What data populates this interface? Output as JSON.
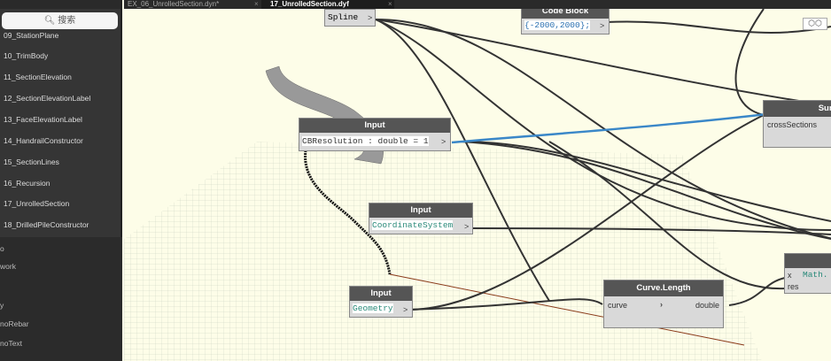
{
  "sidebar": {
    "search_placeholder": "搜索",
    "items": [
      "09_StationPlane",
      "10_TrimBody",
      "11_SectionElevation",
      "12_SectionElevationLabel",
      "13_FaceElevationLabel",
      "14_HandrailConstructor",
      "15_SectionLines",
      "16_Recursion",
      "17_UnrolledSection",
      "18_DrilledPileConstructor"
    ],
    "lower_items": [
      "o",
      "work",
      "",
      "y",
      "noRebar",
      "noText"
    ]
  },
  "tabs": [
    {
      "label": "EX_06_UnrolledSection.dyn*"
    },
    {
      "label": "17_UnrolledSection.dyf"
    }
  ],
  "nodes": {
    "spline": {
      "output": "Spline"
    },
    "code_block": {
      "title": "Code Block",
      "code": "{-2000,2000};"
    },
    "input_cb": {
      "title": "Input",
      "code": "CBResolution : double = 1"
    },
    "input_cs": {
      "title": "Input",
      "code": "CoordinateSystem"
    },
    "input_geo": {
      "title": "Input",
      "code": "Geometry"
    },
    "surface": {
      "title": "Surfa",
      "port": "crossSections"
    },
    "curve_length": {
      "title": "Curve.Length",
      "input": "curve",
      "output": "double"
    },
    "math": {
      "port_x": "x",
      "port_res": "res",
      "code": "Math."
    }
  },
  "colors": {
    "canvas": "#fdfde8",
    "node_header": "#555555",
    "wire": "#333333",
    "wire_selected": "#3a87c8"
  }
}
